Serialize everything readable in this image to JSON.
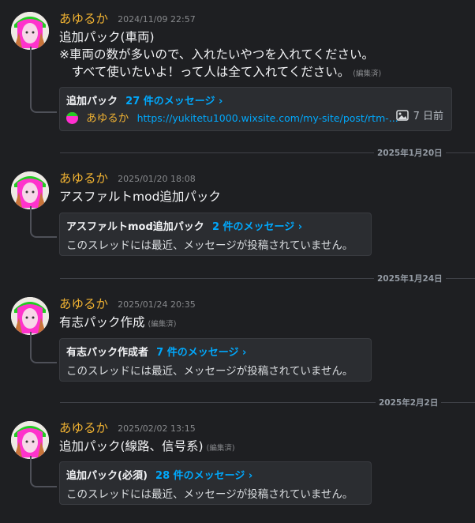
{
  "author": "あゆるか",
  "edited_label": "(編集済)",
  "colors": {
    "background": "#1e1f22",
    "author": "#f0b232",
    "link": "#00a8fc",
    "thread_bg": "#2b2d31"
  },
  "icons": {
    "avatar": "avatar-image",
    "image": "image-icon"
  },
  "messages": [
    {
      "timestamp": "2024/11/09 22:57",
      "lines": [
        "追加パック(車両)",
        "※車両の数が多いので、入れたいやつを入れてください。",
        "　すべて使いたいよ！って人は全て入れてください。"
      ],
      "edited": true,
      "thread": {
        "name": "追加パック",
        "count": "27 件のメッセージ ›",
        "preview_author": "あゆるか",
        "preview_link": "https://yukitetu1000.wixsite.com/my-site/post/rtm-...",
        "age": "7 日前"
      }
    },
    {
      "divider": "2025年1月20日",
      "timestamp": "2025/01/20 18:08",
      "lines": [
        "アスファルトmod追加パック"
      ],
      "edited": false,
      "thread": {
        "name": "アスファルトmod追加パック",
        "count": "2 件のメッセージ ›",
        "preview": "このスレッドには最近、メッセージが投稿されていません。"
      }
    },
    {
      "divider": "2025年1月24日",
      "timestamp": "2025/01/24 20:35",
      "lines": [
        "有志パック作成"
      ],
      "edited": true,
      "thread": {
        "name": "有志パック作成者",
        "count": "7 件のメッセージ ›",
        "preview": "このスレッドには最近、メッセージが投稿されていません。"
      }
    },
    {
      "divider": "2025年2月2日",
      "timestamp": "2025/02/02 13:15",
      "lines": [
        "追加パック(線路、信号系)"
      ],
      "edited": true,
      "thread": {
        "name": "追加パック(必須)",
        "count": "28 件のメッセージ ›",
        "preview": "このスレッドには最近、メッセージが投稿されていません。"
      }
    }
  ]
}
